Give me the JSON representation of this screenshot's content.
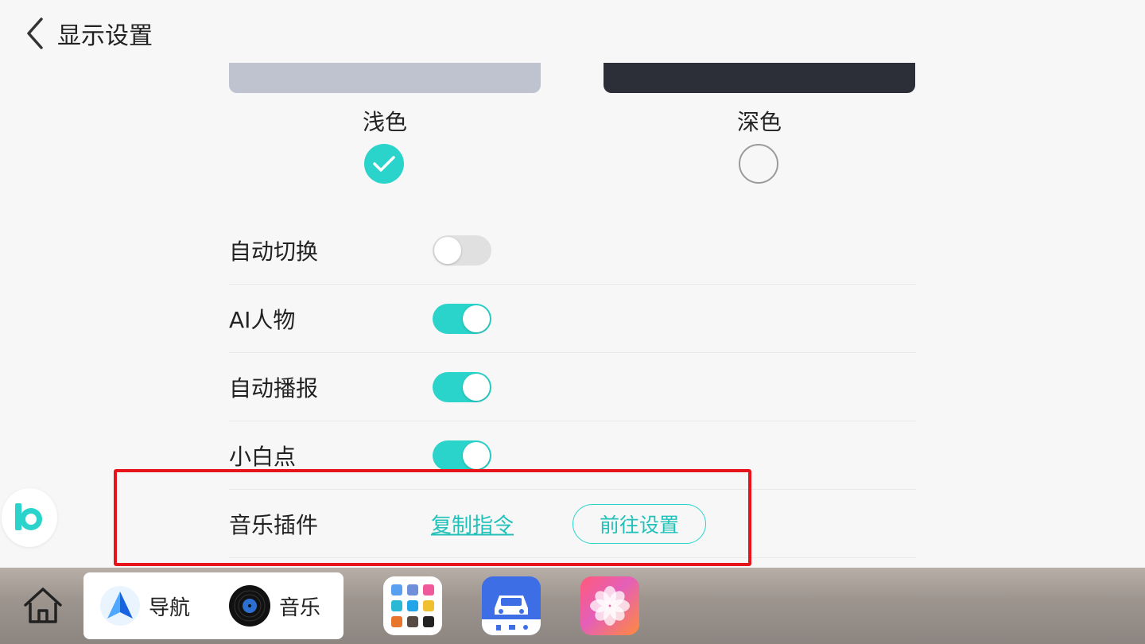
{
  "header": {
    "title": "显示设置"
  },
  "theme": {
    "light_label": "浅色",
    "dark_label": "深色",
    "selected": "light",
    "accent_color": "#2ad4cb"
  },
  "settings": [
    {
      "label": "自动切换",
      "enabled": false
    },
    {
      "label": "AI人物",
      "enabled": true
    },
    {
      "label": "自动播报",
      "enabled": true
    },
    {
      "label": "小白点",
      "enabled": true
    }
  ],
  "music_plugin": {
    "label": "音乐插件",
    "copy_link": "复制指令",
    "goto_button": "前往设置"
  },
  "dock": {
    "nav_label": "导航",
    "music_label": "音乐",
    "apps": [
      "app-grid-icon",
      "car-app-icon",
      "photos-app-icon"
    ]
  }
}
